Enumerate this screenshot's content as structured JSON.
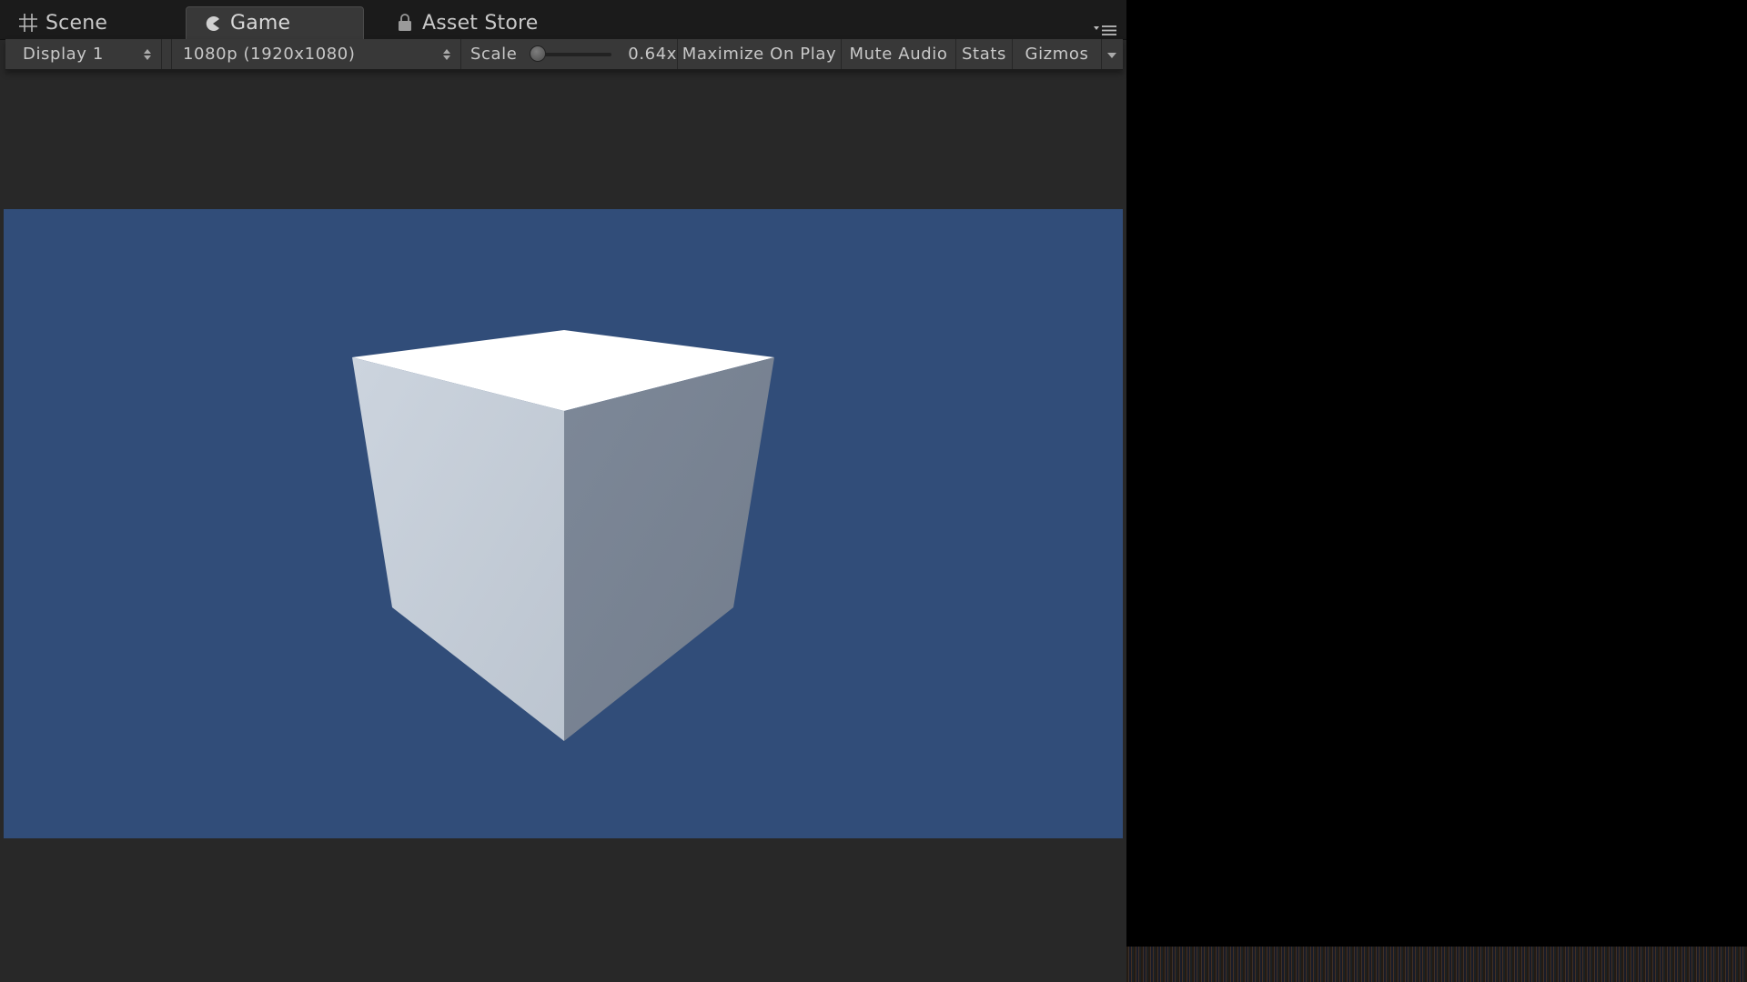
{
  "tabs": [
    {
      "label": "Scene",
      "icon": "grid-icon",
      "active": false
    },
    {
      "label": "Game",
      "icon": "pacman-icon",
      "active": true
    },
    {
      "label": "Asset Store",
      "icon": "lock-bag-icon",
      "active": false
    }
  ],
  "toolbar": {
    "display": "Display 1",
    "resolution": "1080p (1920x1080)",
    "scale_label": "Scale",
    "scale_value": "0.64x",
    "scale_slider_fraction": 0.0,
    "maximize_on_play": "Maximize On Play",
    "mute_audio": "Mute Audio",
    "stats": "Stats",
    "gizmos": "Gizmos"
  },
  "viewport": {
    "background_color": "#314d79",
    "object": "cube",
    "cube_colors": {
      "top": "#ffffff",
      "left": "#c3cbd6",
      "right": "#76808f"
    }
  },
  "colors": {
    "panel_bg": "#282828",
    "tabbar_bg": "#1b1b1b",
    "toolbar_bg": "#383838",
    "text": "#c8c8c8",
    "desktop_bg": "#000000"
  }
}
